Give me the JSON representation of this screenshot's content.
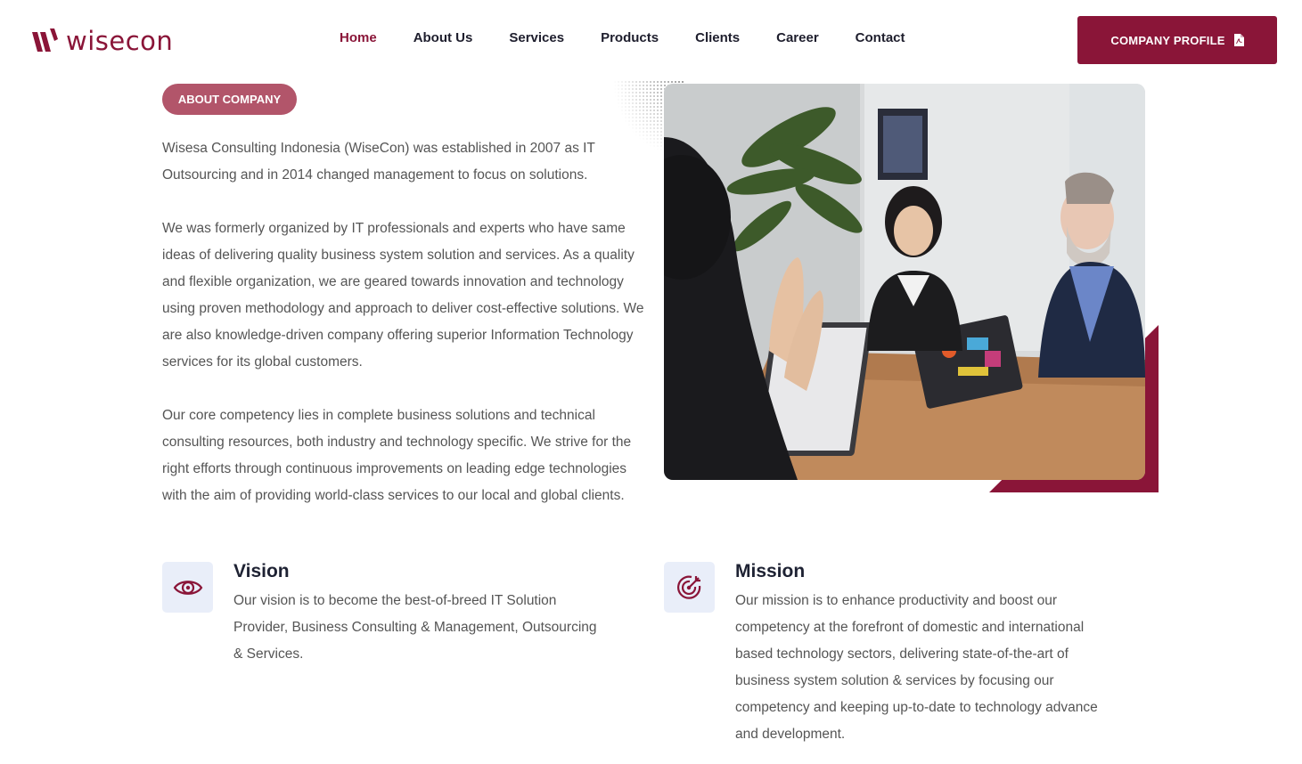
{
  "brand": {
    "name": "wisecon",
    "color": "#8a1538"
  },
  "nav": {
    "items": [
      {
        "label": "Home",
        "active": true
      },
      {
        "label": "About Us"
      },
      {
        "label": "Services"
      },
      {
        "label": "Products"
      },
      {
        "label": "Clients"
      },
      {
        "label": "Career"
      },
      {
        "label": "Contact"
      }
    ],
    "cta_label": "COMPANY PROFILE",
    "cta_icon": "pdf-file-icon"
  },
  "about": {
    "badge": "ABOUT COMPANY",
    "paragraphs": [
      "Wisesa Consulting Indonesia (WiseCon) was established in 2007 as IT Outsourcing and in 2014 changed management to focus on solutions.",
      "We was formerly organized by IT professionals and experts who have same ideas of delivering quality business system solution and services. As a quality and flexible organization, we are geared towards innovation and technology using proven methodology and approach to deliver cost-effective solutions. We are also knowledge-driven company offering superior Information Technology services for its global customers.",
      "Our core competency lies in complete business solutions and technical consulting resources, both industry and technology specific. We strive for the right efforts through continuous improvements on leading edge technologies with the aim of providing world-class services to our local and global clients."
    ]
  },
  "vision": {
    "title": "Vision",
    "text": "Our vision is to become the best-of-breed IT Solution Provider, Business Consulting & Management, Outsourcing & Services.",
    "icon": "eye-icon"
  },
  "mission": {
    "title": "Mission",
    "text": "Our mission is to enhance productivity and boost our competency at the forefront of domestic and international based technology sectors, delivering state-of-the-art of business system solution & services by focusing our competency and keeping up-to-date to technology advance and development.",
    "icon": "target-icon"
  },
  "colors": {
    "accent": "#8a1538",
    "badge": "#b2556a",
    "icon_bg": "#e9eef9"
  }
}
